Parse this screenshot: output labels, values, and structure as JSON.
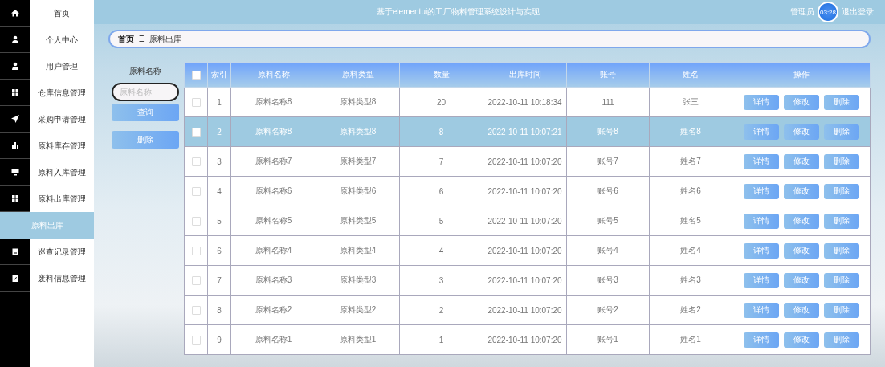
{
  "sidebar": {
    "items": [
      {
        "label": "首页",
        "selected": false
      },
      {
        "label": "个人中心",
        "selected": false
      },
      {
        "label": "用户管理",
        "selected": false
      },
      {
        "label": "仓库信息管理",
        "selected": false
      },
      {
        "label": "采购申请管理",
        "selected": false
      },
      {
        "label": "原料库存管理",
        "selected": false
      },
      {
        "label": "原料入库管理",
        "selected": false
      },
      {
        "label": "原料出库管理",
        "selected": false,
        "children": [
          {
            "label": "原料出库",
            "selected": true
          }
        ]
      },
      {
        "label": "巡查记录管理",
        "selected": false
      },
      {
        "label": "废料信息管理",
        "selected": false
      }
    ]
  },
  "header": {
    "title": "基于elementui的工厂物料管理系统设计与实现",
    "user": "管理员",
    "clock": "03:28",
    "logout": "退出登录"
  },
  "breadcrumb": {
    "home": "首页",
    "separator": "Ξ",
    "current": "原料出库"
  },
  "search": {
    "label": "原料名称",
    "placeholder": "原料名称",
    "query_button": "查询",
    "delete_button": "删除"
  },
  "table": {
    "header_checked": false,
    "columns": [
      "索引",
      "原料名称",
      "原料类型",
      "数量",
      "出库时间",
      "账号",
      "姓名",
      "操作"
    ],
    "rows": [
      {
        "selected": false,
        "checked": false,
        "cells": [
          "1",
          "原料名称8",
          "原料类型8",
          "20",
          "2022-10-11 10:18:34",
          "111",
          "张三"
        ],
        "actions": [
          "详情",
          "修改",
          "删除"
        ]
      },
      {
        "selected": true,
        "checked": false,
        "cells": [
          "2",
          "原料名称8",
          "原料类型8",
          "8",
          "2022-10-11 10:07:21",
          "账号8",
          "姓名8"
        ],
        "actions": [
          "详情",
          "修改",
          "删除"
        ]
      },
      {
        "selected": false,
        "checked": false,
        "cells": [
          "3",
          "原料名称7",
          "原料类型7",
          "7",
          "2022-10-11 10:07:20",
          "账号7",
          "姓名7"
        ],
        "actions": [
          "详情",
          "修改",
          "删除"
        ]
      },
      {
        "selected": false,
        "checked": false,
        "cells": [
          "4",
          "原料名称6",
          "原料类型6",
          "6",
          "2022-10-11 10:07:20",
          "账号6",
          "姓名6"
        ],
        "actions": [
          "详情",
          "修改",
          "删除"
        ]
      },
      {
        "selected": false,
        "checked": false,
        "cells": [
          "5",
          "原料名称5",
          "原料类型5",
          "5",
          "2022-10-11 10:07:20",
          "账号5",
          "姓名5"
        ],
        "actions": [
          "详情",
          "修改",
          "删除"
        ]
      },
      {
        "selected": false,
        "checked": false,
        "cells": [
          "6",
          "原料名称4",
          "原料类型4",
          "4",
          "2022-10-11 10:07:20",
          "账号4",
          "姓名4"
        ],
        "actions": [
          "详情",
          "修改",
          "删除"
        ]
      },
      {
        "selected": false,
        "checked": false,
        "cells": [
          "7",
          "原料名称3",
          "原料类型3",
          "3",
          "2022-10-11 10:07:20",
          "账号3",
          "姓名3"
        ],
        "actions": [
          "详情",
          "修改",
          "删除"
        ]
      },
      {
        "selected": false,
        "checked": false,
        "cells": [
          "8",
          "原料名称2",
          "原料类型2",
          "2",
          "2022-10-11 10:07:20",
          "账号2",
          "姓名2"
        ],
        "actions": [
          "详情",
          "修改",
          "删除"
        ]
      },
      {
        "selected": false,
        "checked": false,
        "cells": [
          "9",
          "原料名称1",
          "原料类型1",
          "1",
          "2022-10-11 10:07:20",
          "账号1",
          "姓名1"
        ],
        "actions": [
          "详情",
          "修改",
          "删除"
        ]
      }
    ]
  }
}
